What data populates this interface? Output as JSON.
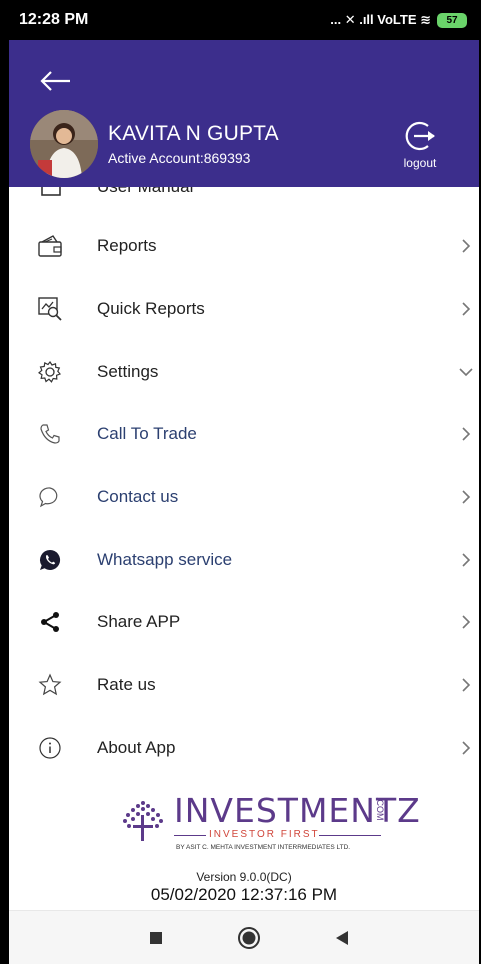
{
  "status_bar": {
    "time": "12:28 PM",
    "indicators": "... ✕ .ıll VoLTE ≋",
    "battery": "57"
  },
  "header": {
    "user_name": "KAVITA N GUPTA",
    "account": "Active Account:869393",
    "logout_label": "logout",
    "background": "#3c2e8c"
  },
  "menu": {
    "partial_item": "User Manual",
    "items": [
      {
        "label": "Reports",
        "icon": "wallet-icon",
        "chevron": "right"
      },
      {
        "label": "Quick Reports",
        "icon": "chart-search-icon",
        "chevron": "right"
      },
      {
        "label": "Settings",
        "icon": "gear-icon",
        "chevron": "down"
      },
      {
        "label": "Call To Trade",
        "icon": "phone-icon",
        "chevron": "right"
      },
      {
        "label": "Contact us",
        "icon": "chat-bubble-icon",
        "chevron": "right"
      },
      {
        "label": "Whatsapp service",
        "icon": "whatsapp-icon",
        "chevron": "right"
      },
      {
        "label": "Share APP",
        "icon": "share-icon",
        "chevron": "right"
      },
      {
        "label": "Rate us",
        "icon": "star-icon",
        "chevron": "right"
      },
      {
        "label": "About App",
        "icon": "info-icon",
        "chevron": "right"
      }
    ]
  },
  "footer": {
    "logo_text": "INVESTMENTZ",
    "logo_com": ".COM",
    "tagline": "INVESTOR FIRST",
    "subline": "BY ASIT C. MEHTA INVESTMENT INTERRMEDIATES LTD.",
    "version": "Version 9.0.0(DC)",
    "datetime": "05/02/2020 12:37:16 PM"
  },
  "colors": {
    "brand_purple": "#3c2e8c",
    "logo_purple": "#5c3a8a",
    "tagline_red": "#d0453a"
  }
}
